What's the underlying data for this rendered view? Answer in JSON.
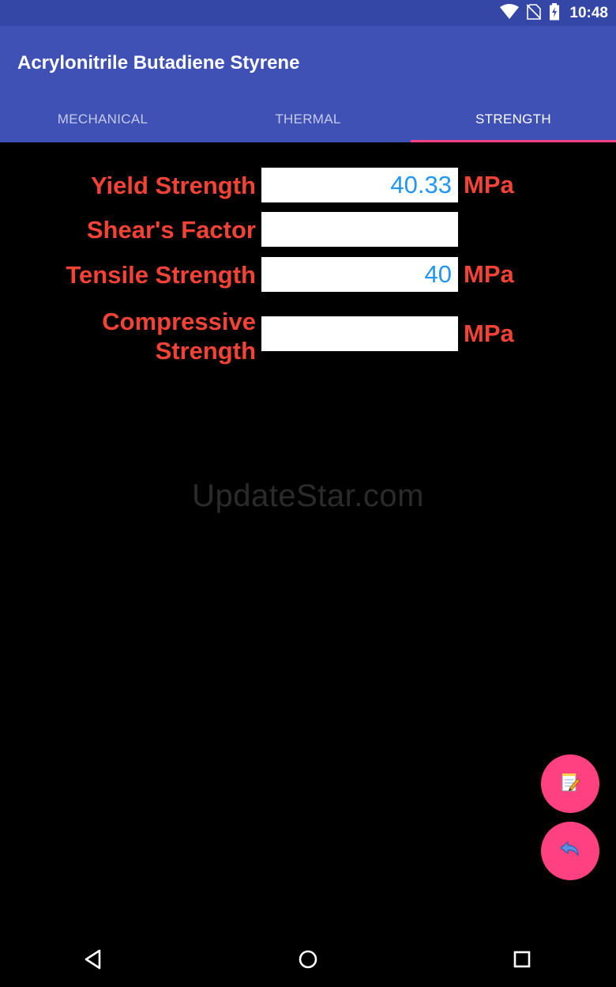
{
  "status": {
    "time": "10:48"
  },
  "app": {
    "title": "Acrylonitrile Butadiene Styrene"
  },
  "tabs": [
    {
      "label": "MECHANICAL"
    },
    {
      "label": "THERMAL"
    },
    {
      "label": "STRENGTH"
    }
  ],
  "fields": [
    {
      "label": "Yield Strength",
      "value": "40.33",
      "unit": "MPa"
    },
    {
      "label": "Shear's Factor",
      "value": "",
      "unit": ""
    },
    {
      "label": "Tensile Strength",
      "value": "40",
      "unit": "MPa"
    },
    {
      "label_line1": "Compressive",
      "label_line2": "Strength",
      "value": "",
      "unit": "MPa"
    }
  ],
  "watermark": "UpdateStar.com",
  "fabs": {
    "edit_icon": "notepad-icon",
    "back_icon": "undo-icon"
  },
  "colors": {
    "primary": "#3f51b5",
    "status": "#3446a6",
    "accent": "#ff4081",
    "label": "#f44336",
    "value": "#2196f3"
  }
}
